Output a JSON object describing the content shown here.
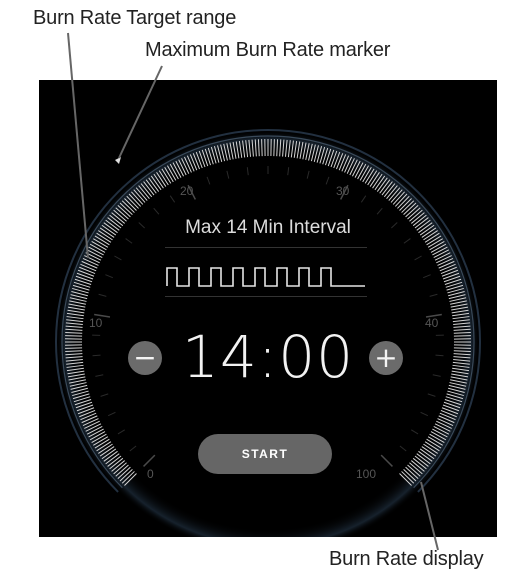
{
  "callouts": {
    "target_range": "Burn Rate Target range",
    "max_marker": "Maximum Burn Rate marker",
    "display": "Burn Rate display"
  },
  "dial": {
    "scale_labels": [
      "0",
      "10",
      "20",
      "30",
      "40",
      "100"
    ]
  },
  "interval": {
    "title": "Max 14 Min Interval"
  },
  "timer": {
    "value": "14:00",
    "decrease_symbol": "−",
    "increase_symbol": "+"
  },
  "start_button": {
    "label": "START"
  },
  "colors": {
    "panel_background": "#000000",
    "tick_color": "#d8d8d8",
    "button_gray": "#6b6b6b",
    "ring_blue": "#2a3a4a"
  }
}
